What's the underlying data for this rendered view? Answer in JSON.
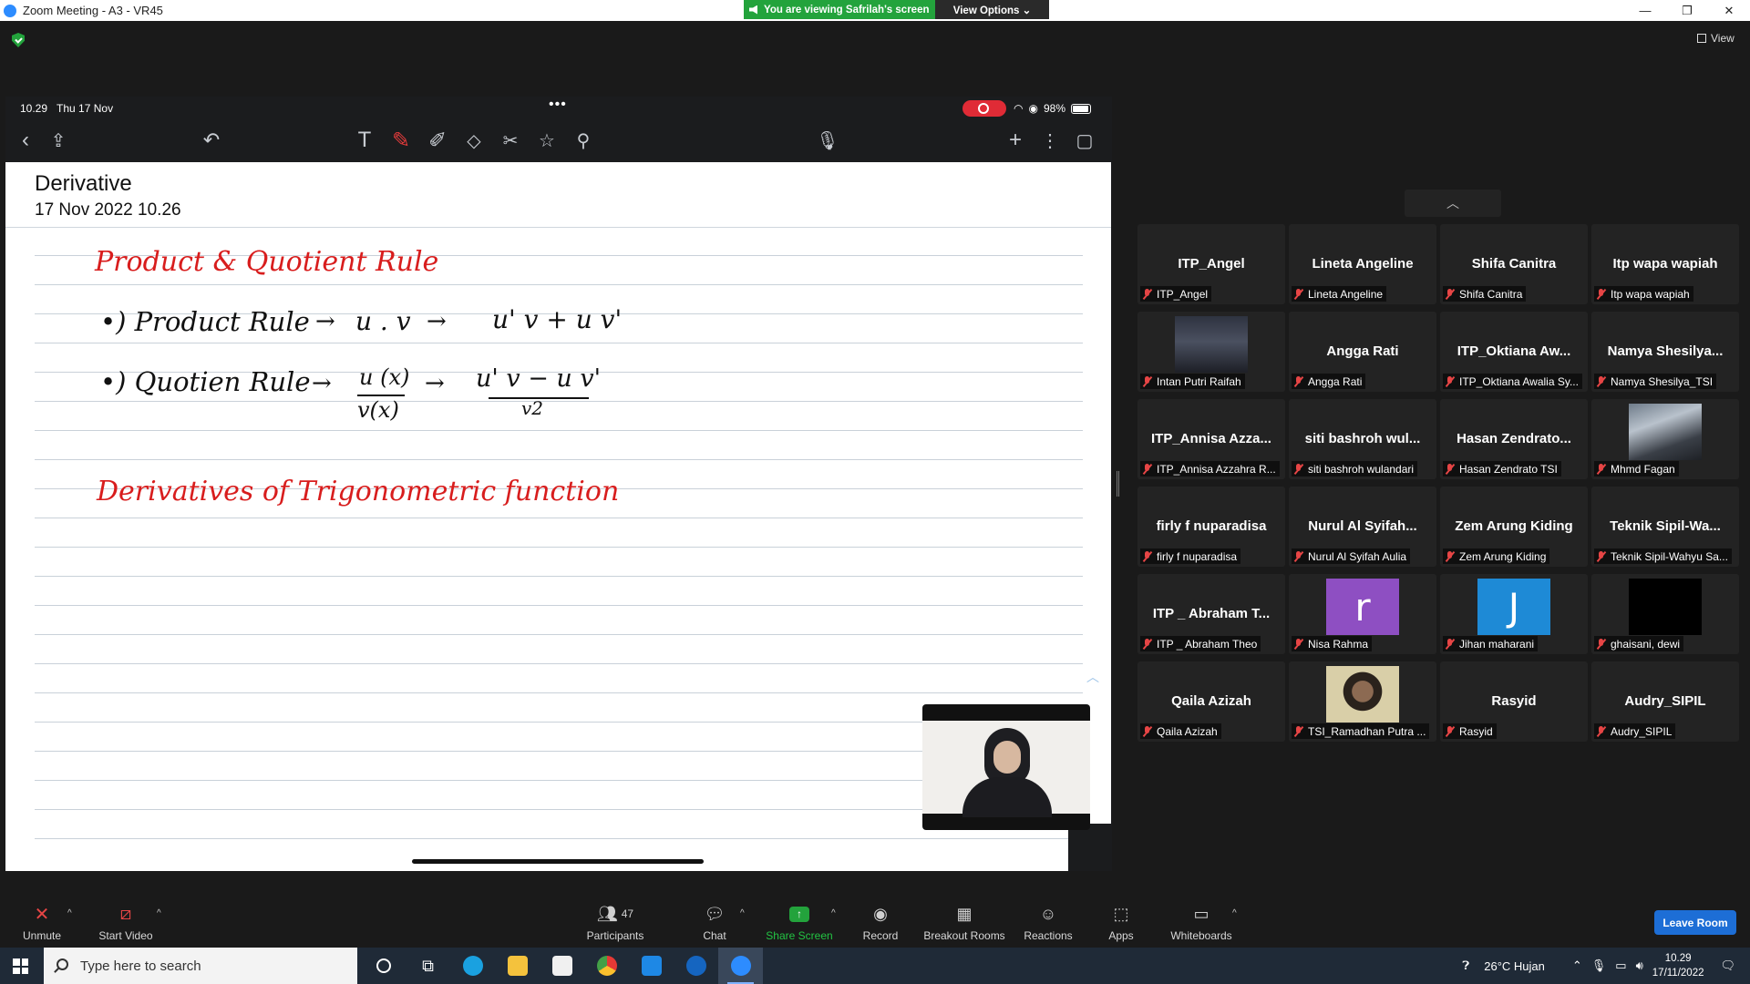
{
  "window": {
    "title": "Zoom Meeting - A3 - VR45",
    "viewing_banner": "You are viewing Safrilah's screen",
    "view_options": "View Options ⌄",
    "view_label": "View"
  },
  "ipad": {
    "time": "10.29",
    "date": "Thu 17 Nov",
    "battery": "98%",
    "more": "•••"
  },
  "note": {
    "title": "Derivative",
    "date": "17 Nov 2022 10.26",
    "heading1": "Product & Quotient Rule",
    "product_label": "•) Product Rule",
    "product_arrow1": "→",
    "product_uv": "u . v",
    "product_arrow2": "→",
    "product_result": "u' v + u v'",
    "quotient_label": "•) Quotien Rule",
    "quotient_arrow1": "→",
    "quotient_num": "u (x)",
    "quotient_den": "v(x)",
    "quotient_arrow2": "→",
    "quotient_res_num": "u' v − u v'",
    "quotient_res_den": "v2",
    "heading2": "Derivatives of Trigonometric function"
  },
  "participants": [
    {
      "name": "ITP_Angel",
      "label": "ITP_Angel",
      "thumb": "none"
    },
    {
      "name": "Lineta Angeline",
      "label": "Lineta Angeline",
      "thumb": "none"
    },
    {
      "name": "Shifa Canitra",
      "label": "Shifa Canitra",
      "thumb": "none"
    },
    {
      "name": "Itp wapa wapiah",
      "label": "Itp wapa wapiah",
      "thumb": "none"
    },
    {
      "name": "",
      "label": "Intan Putri Raifah",
      "thumb": "photo-city"
    },
    {
      "name": "Angga Rati",
      "label": "Angga Rati",
      "thumb": "none"
    },
    {
      "name": "ITP_Oktiana Aw...",
      "label": "ITP_Oktiana Awalia Sy...",
      "thumb": "none"
    },
    {
      "name": "Namya Shesilya...",
      "label": "Namya Shesilya_TSI",
      "thumb": "none"
    },
    {
      "name": "ITP_Annisa Azza...",
      "label": "ITP_Annisa Azzahra R...",
      "thumb": "none"
    },
    {
      "name": "siti bashroh wul...",
      "label": "siti bashroh wulandari",
      "thumb": "none"
    },
    {
      "name": "Hasan Zendrato...",
      "label": "Hasan Zendrato TSI",
      "thumb": "none"
    },
    {
      "name": "",
      "label": "Mhmd Fagan",
      "thumb": "photo-street"
    },
    {
      "name": "firly f nuparadisa",
      "label": "firly f nuparadisa",
      "thumb": "none"
    },
    {
      "name": "Nurul Al Syifah...",
      "label": "Nurul Al Syifah Aulia",
      "thumb": "none"
    },
    {
      "name": "Zem Arung Kiding",
      "label": "Zem Arung Kiding",
      "thumb": "none"
    },
    {
      "name": "Teknik Sipil-Wa...",
      "label": "Teknik Sipil-Wahyu Sa...",
      "thumb": "none"
    },
    {
      "name": "ITP _ Abraham T...",
      "label": "ITP _ Abraham Theo",
      "thumb": "none"
    },
    {
      "name": "",
      "label": "Nisa Rahma",
      "thumb": "letter",
      "letter": "r",
      "color": "#8e4fc2"
    },
    {
      "name": "",
      "label": "Jihan maharani",
      "thumb": "letter",
      "letter": "J",
      "color": "#1e8ad6"
    },
    {
      "name": "",
      "label": "ghaisani, dewi",
      "thumb": "black"
    },
    {
      "name": "Qaila Azizah",
      "label": "Qaila Azizah",
      "thumb": "none"
    },
    {
      "name": "",
      "label": "TSI_Ramadhan Putra ...",
      "thumb": "photo-person"
    },
    {
      "name": "Rasyid",
      "label": "Rasyid",
      "thumb": "none"
    },
    {
      "name": "Audry_SIPIL",
      "label": "Audry_SIPIL",
      "thumb": "none"
    }
  ],
  "toolbar": {
    "unmute": "Unmute",
    "start_video": "Start Video",
    "participants": "Participants",
    "participants_count": "47",
    "chat": "Chat",
    "share_screen": "Share Screen",
    "record": "Record",
    "breakout": "Breakout Rooms",
    "reactions": "Reactions",
    "apps": "Apps",
    "whiteboards": "Whiteboards",
    "leave": "Leave Room"
  },
  "taskbar": {
    "search_placeholder": "Type here to search",
    "weather": "26°C  Hujan",
    "time": "10.29",
    "date": "17/11/2022"
  },
  "colors": {
    "share_green": "#23a33c",
    "leave_blue": "#1d6ed6",
    "ink_red": "#d81d1d",
    "zoom_blue": "#2d8cff"
  }
}
